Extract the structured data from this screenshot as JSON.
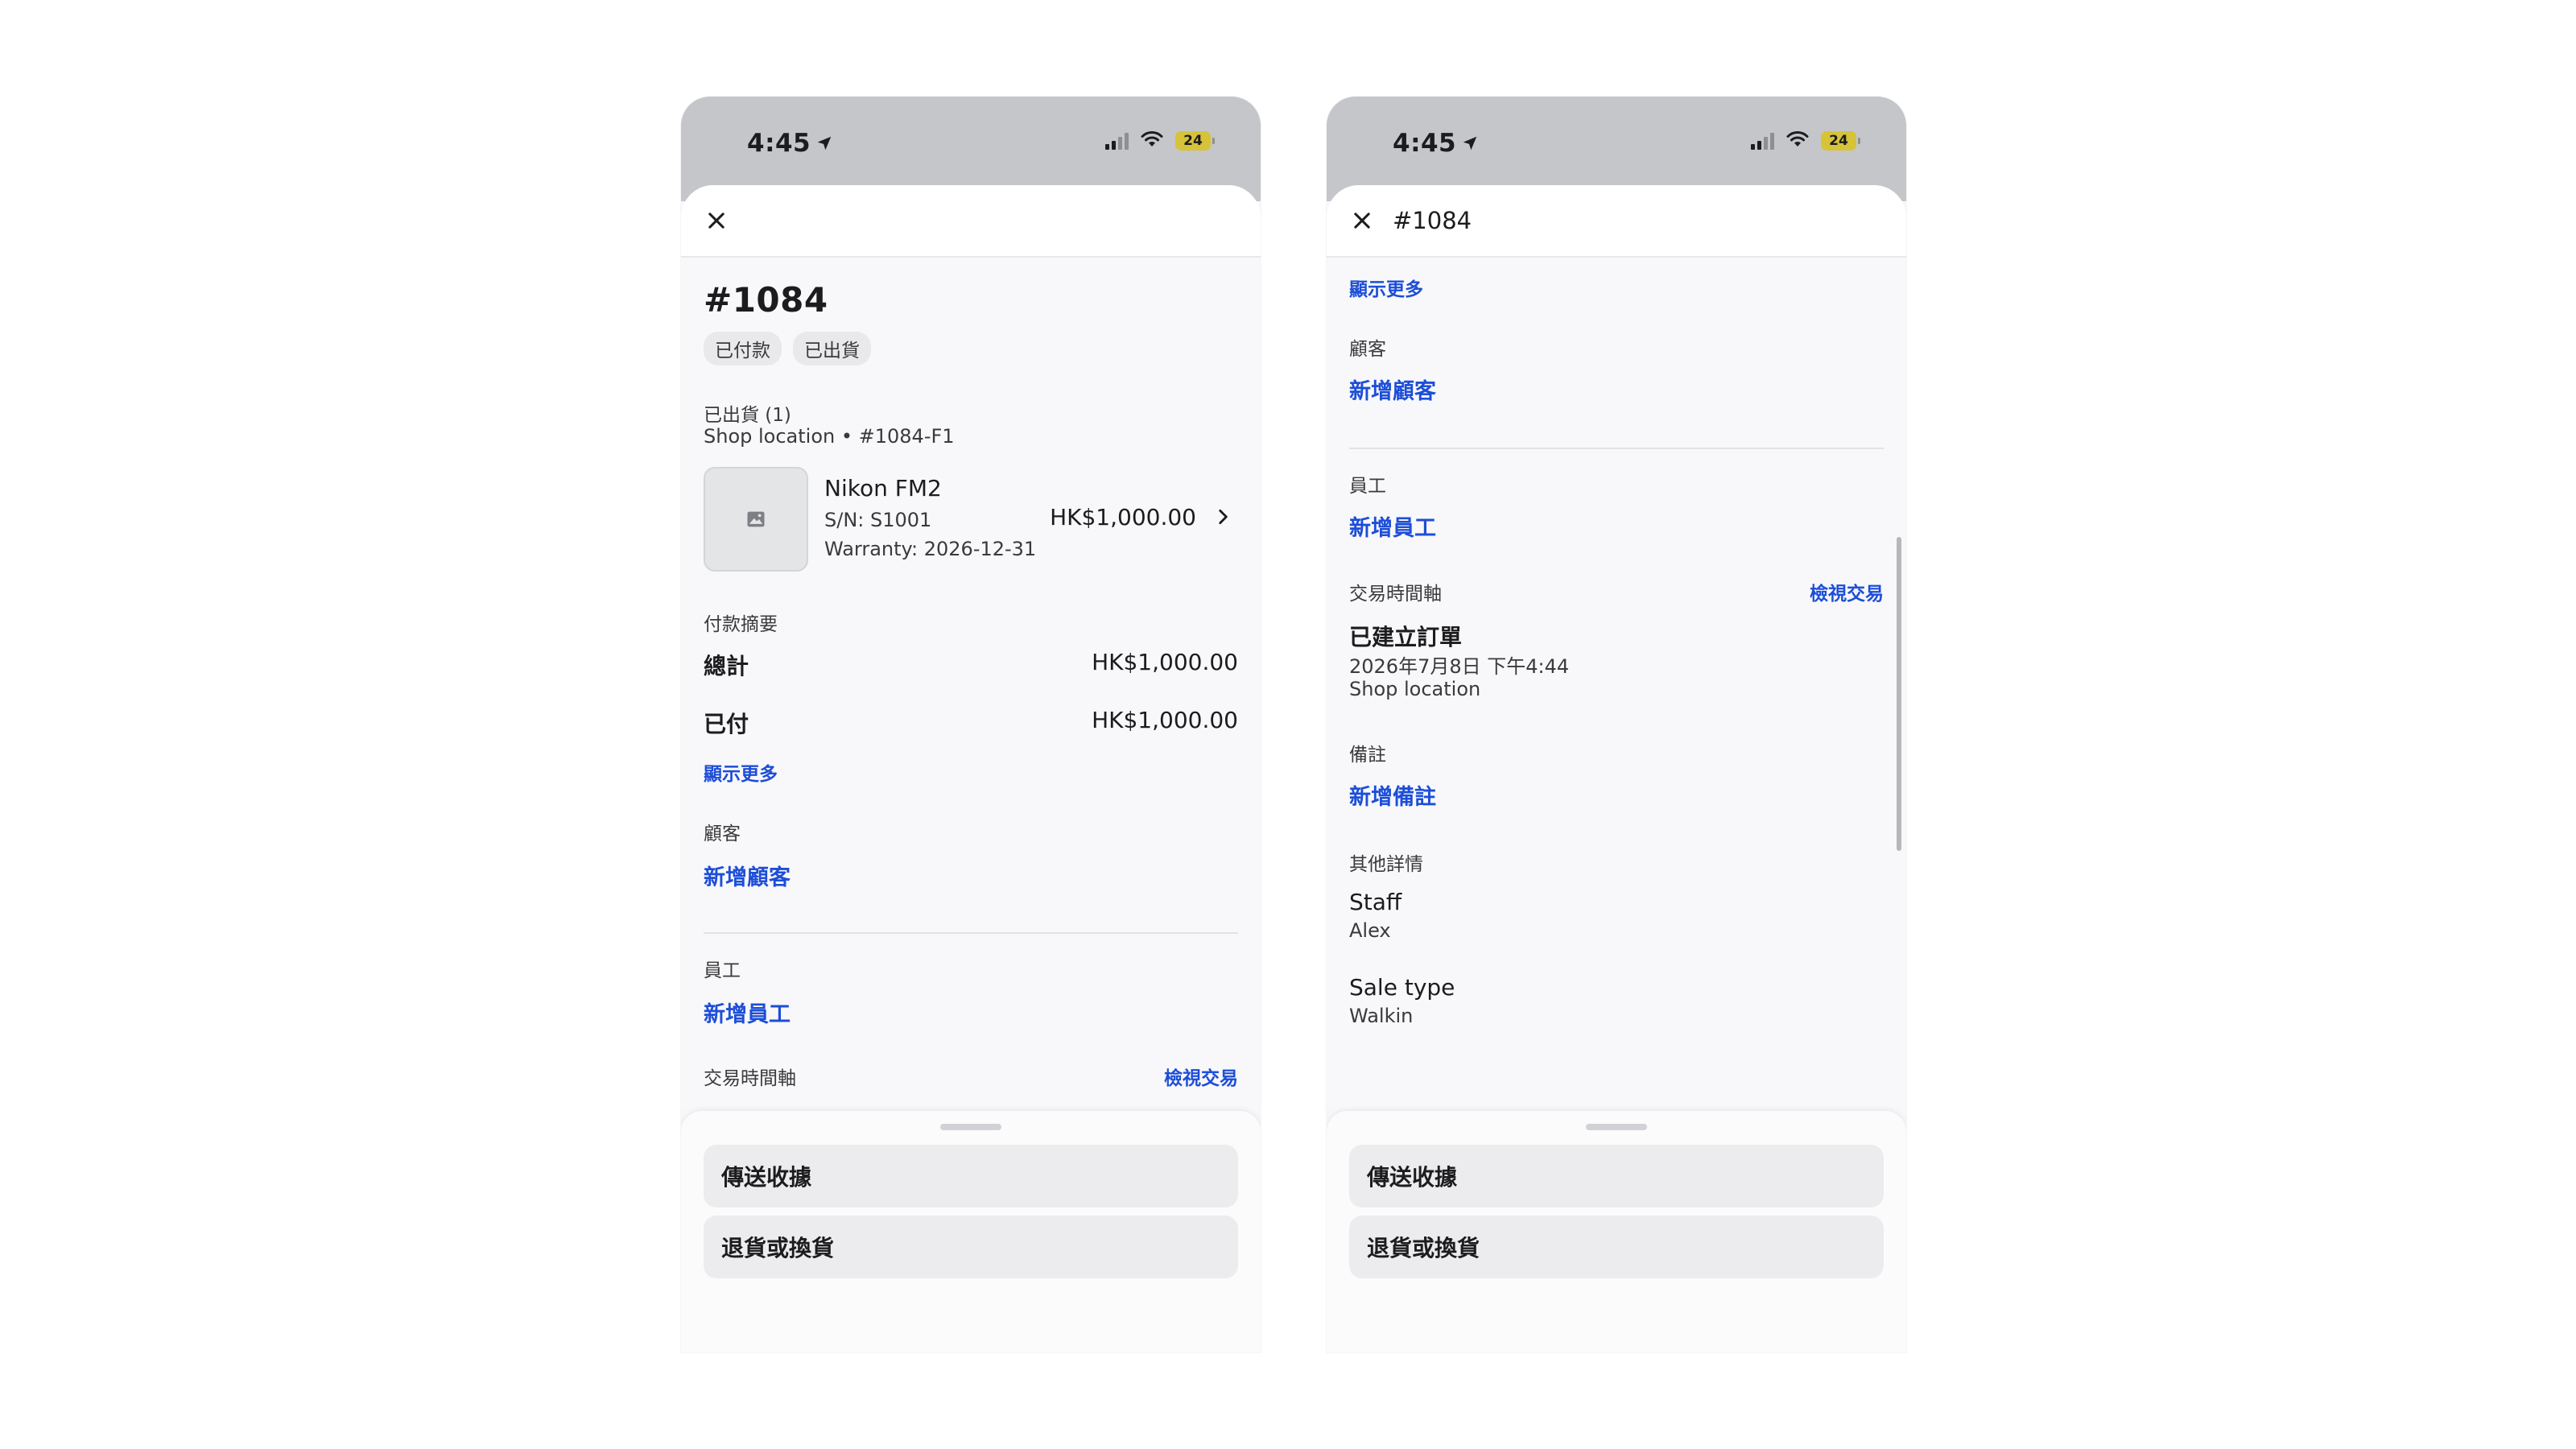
{
  "status_bar": {
    "time": "4:45",
    "battery": "24"
  },
  "order": {
    "number": "#1084",
    "badges": [
      "已付款",
      "已出貨"
    ],
    "fulfillment_label": "已出貨 (1)",
    "fulfillment_location": "Shop location • #1084-F1",
    "item": {
      "name": "Nikon FM2",
      "serial": "S/N: S1001",
      "warranty": "Warranty: 2026-12-31",
      "price": "HK$1,000.00"
    },
    "payment": {
      "label": "付款摘要",
      "total_label": "總計",
      "total_value": "HK$1,000.00",
      "paid_label": "已付",
      "paid_value": "HK$1,000.00",
      "show_more": "顯示更多"
    },
    "customer": {
      "label": "顧客",
      "add_link": "新增顧客"
    },
    "staff": {
      "label": "員工",
      "add_link": "新增員工"
    },
    "timeline": {
      "label": "交易時間軸",
      "view_link": "檢視交易",
      "event_title": "已建立訂單",
      "event_time": "2026年7月8日 下午4:44",
      "event_location": "Shop location"
    },
    "notes": {
      "label": "備註",
      "add_link": "新增備註"
    },
    "other_details": {
      "label": "其他詳情",
      "staff_title": "Staff",
      "staff_value": "Alex",
      "sale_type_title": "Sale type",
      "sale_type_value": "Walkin"
    }
  },
  "actions": {
    "send_receipt": "傳送收據",
    "return_exchange": "退貨或換貨"
  },
  "colors": {
    "link": "#1d4ed8",
    "status_bar": "#c4c6c9",
    "battery": "#d6c33a"
  },
  "icons": [
    "close-icon",
    "location-arrow-icon",
    "signal-icon",
    "wifi-icon",
    "battery-icon",
    "image-placeholder-icon",
    "chevron-right-icon"
  ]
}
